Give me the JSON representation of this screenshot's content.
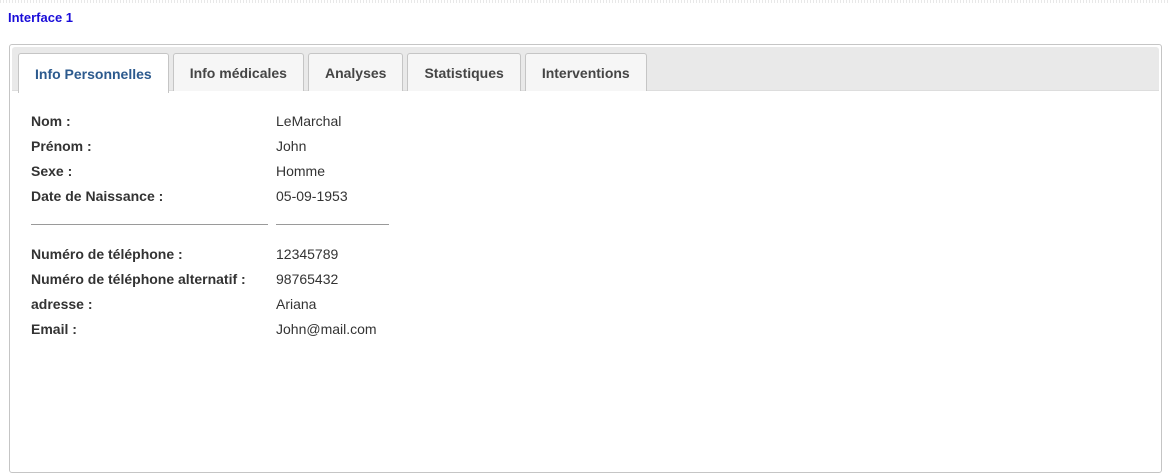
{
  "header": {
    "title": "Interface 1"
  },
  "tabs": [
    {
      "label": "Info Personnelles",
      "active": true
    },
    {
      "label": "Info médicales",
      "active": false
    },
    {
      "label": "Analyses",
      "active": false
    },
    {
      "label": "Statistiques",
      "active": false
    },
    {
      "label": "Interventions",
      "active": false
    }
  ],
  "personal_info": [
    {
      "label": "Nom :",
      "value": "LeMarchal"
    },
    {
      "label": "Prénom :",
      "value": "John"
    },
    {
      "label": "Sexe :",
      "value": "Homme"
    },
    {
      "label": "Date de Naissance :",
      "value": "05-09-1953"
    }
  ],
  "contact_info": [
    {
      "label": "Numéro de téléphone :",
      "value": "12345789"
    },
    {
      "label": "Numéro de téléphone alternatif :",
      "value": "98765432"
    },
    {
      "label": "adresse :",
      "value": "Ariana"
    },
    {
      "label": "Email :",
      "value": "John@mail.com"
    }
  ],
  "colors": {
    "header_link": "#1a0dd9",
    "active_tab_text": "#2c5a8e",
    "tabbar_bg": "#e9e9e9"
  }
}
